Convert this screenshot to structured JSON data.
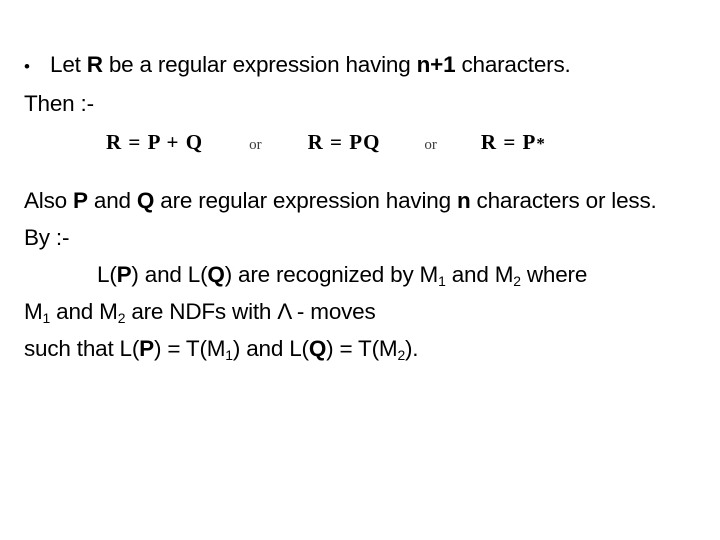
{
  "slide": {
    "background_color": "#ffffff",
    "text_color": "#000000",
    "bullet": {
      "marker": "bullet-glyph",
      "prefix": "Let ",
      "symbol_r": "R",
      "middle": " be a regular expression having ",
      "count": "n+1",
      "suffix": " characters."
    },
    "then_label": "Then :-",
    "formulas": {
      "first": "R = P + Q",
      "or_1": "or",
      "second": "R = PQ",
      "or_2": "or",
      "third_lead": "R = P",
      "third_star": "*"
    },
    "also_line": {
      "lead": "Also ",
      "symbol_p": "P",
      "mid1": " and ",
      "symbol_q": "Q",
      "mid2": " are regular expression having ",
      "symbol_n": "n",
      "tail": " characters or less."
    },
    "by_label": "By :-",
    "recognized_line": {
      "lead": "L(",
      "symbol_p": "P",
      "mid1": ") and L(",
      "symbol_q": "Q",
      "mid2": ") are recognized by M",
      "sub1": "1",
      "mid3": " and M",
      "sub2": "2",
      "tail": "  where"
    },
    "ndf_line": {
      "lead": "M",
      "sub1": "1",
      "mid": " and M",
      "sub2": "2",
      "tail": " are NDFs with Λ - moves"
    },
    "such_that_line": {
      "lead": "such that L(",
      "symbol_p": "P",
      "mid1": ") = T(M",
      "sub1": "1",
      "mid2": ") and L(",
      "symbol_q": "Q",
      "mid3": ") = T(M",
      "sub2": "2",
      "tail": ")."
    }
  }
}
